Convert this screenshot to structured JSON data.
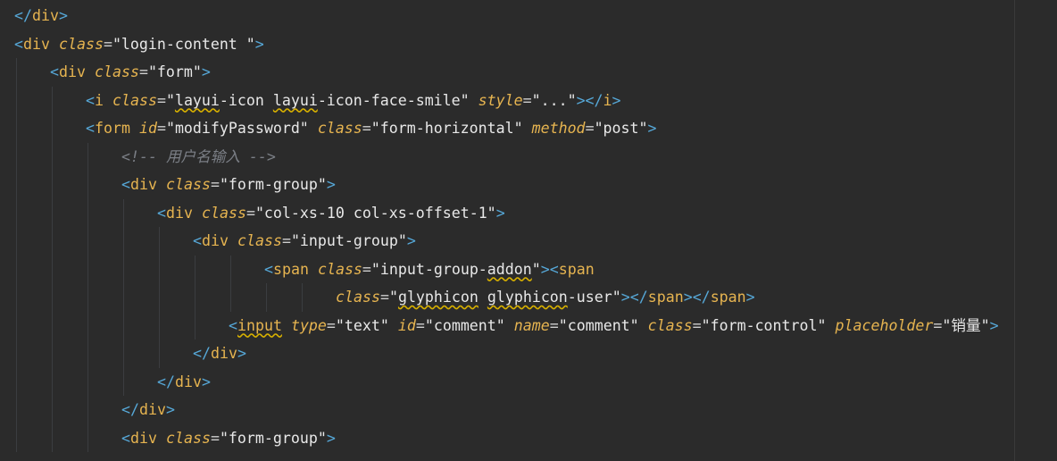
{
  "editor": {
    "language": "html",
    "lines": [
      {
        "indent": 0,
        "tokens": [
          {
            "k": "b",
            "v": "</"
          },
          {
            "k": "t",
            "v": "div"
          },
          {
            "k": "b",
            "v": ">"
          }
        ]
      },
      {
        "indent": 0,
        "tokens": [
          {
            "k": "b",
            "v": "<"
          },
          {
            "k": "t",
            "v": "div"
          },
          {
            "k": "p",
            "v": " "
          },
          {
            "k": "a",
            "v": "class"
          },
          {
            "k": "p",
            "v": "="
          },
          {
            "k": "s",
            "v": "\"login-content \""
          },
          {
            "k": "b",
            "v": ">"
          }
        ]
      },
      {
        "indent": 2,
        "tokens": [
          {
            "k": "b",
            "v": "<"
          },
          {
            "k": "t",
            "v": "div"
          },
          {
            "k": "p",
            "v": " "
          },
          {
            "k": "a",
            "v": "class"
          },
          {
            "k": "p",
            "v": "="
          },
          {
            "k": "s",
            "v": "\"form\""
          },
          {
            "k": "b",
            "v": ">"
          }
        ]
      },
      {
        "indent": 4,
        "tokens": [
          {
            "k": "b",
            "v": "<"
          },
          {
            "k": "t",
            "v": "i"
          },
          {
            "k": "p",
            "v": " "
          },
          {
            "k": "a",
            "v": "class"
          },
          {
            "k": "p",
            "v": "="
          },
          {
            "k": "s",
            "v": "\""
          },
          {
            "k": "s",
            "v": "layui",
            "sq": true
          },
          {
            "k": "s",
            "v": "-icon "
          },
          {
            "k": "s",
            "v": "layui",
            "sq": true
          },
          {
            "k": "s",
            "v": "-icon-face-smile\""
          },
          {
            "k": "p",
            "v": " "
          },
          {
            "k": "a",
            "v": "style"
          },
          {
            "k": "p",
            "v": "="
          },
          {
            "k": "s",
            "v": "\"...\""
          },
          {
            "k": "b",
            "v": "></"
          },
          {
            "k": "t",
            "v": "i"
          },
          {
            "k": "b",
            "v": ">"
          }
        ]
      },
      {
        "indent": 4,
        "tokens": [
          {
            "k": "b",
            "v": "<"
          },
          {
            "k": "t",
            "v": "form"
          },
          {
            "k": "p",
            "v": " "
          },
          {
            "k": "a",
            "v": "id"
          },
          {
            "k": "p",
            "v": "="
          },
          {
            "k": "s",
            "v": "\"modifyPassword\""
          },
          {
            "k": "p",
            "v": " "
          },
          {
            "k": "a",
            "v": "class"
          },
          {
            "k": "p",
            "v": "="
          },
          {
            "k": "s",
            "v": "\"form-horizontal\""
          },
          {
            "k": "p",
            "v": " "
          },
          {
            "k": "a",
            "v": "method"
          },
          {
            "k": "p",
            "v": "="
          },
          {
            "k": "s",
            "v": "\"post\""
          },
          {
            "k": "b",
            "v": ">"
          }
        ]
      },
      {
        "indent": 6,
        "tokens": [
          {
            "k": "c",
            "v": "<!-- 用户名输入 -->"
          }
        ]
      },
      {
        "indent": 6,
        "tokens": [
          {
            "k": "b",
            "v": "<"
          },
          {
            "k": "t",
            "v": "div"
          },
          {
            "k": "p",
            "v": " "
          },
          {
            "k": "a",
            "v": "class"
          },
          {
            "k": "p",
            "v": "="
          },
          {
            "k": "s",
            "v": "\"form-group\""
          },
          {
            "k": "b",
            "v": ">"
          }
        ]
      },
      {
        "indent": 8,
        "tokens": [
          {
            "k": "b",
            "v": "<"
          },
          {
            "k": "t",
            "v": "div"
          },
          {
            "k": "p",
            "v": " "
          },
          {
            "k": "a",
            "v": "class"
          },
          {
            "k": "p",
            "v": "="
          },
          {
            "k": "s",
            "v": "\"col-xs-10 col-xs-offset-1\""
          },
          {
            "k": "b",
            "v": ">"
          }
        ]
      },
      {
        "indent": 10,
        "tokens": [
          {
            "k": "b",
            "v": "<"
          },
          {
            "k": "t",
            "v": "div"
          },
          {
            "k": "p",
            "v": " "
          },
          {
            "k": "a",
            "v": "class"
          },
          {
            "k": "p",
            "v": "="
          },
          {
            "k": "s",
            "v": "\"input-group\""
          },
          {
            "k": "b",
            "v": ">"
          }
        ]
      },
      {
        "indent": 14,
        "tokens": [
          {
            "k": "b",
            "v": "<"
          },
          {
            "k": "t",
            "v": "span"
          },
          {
            "k": "p",
            "v": " "
          },
          {
            "k": "a",
            "v": "class"
          },
          {
            "k": "p",
            "v": "="
          },
          {
            "k": "s",
            "v": "\"input-group-"
          },
          {
            "k": "s",
            "v": "addon",
            "sq": true
          },
          {
            "k": "s",
            "v": "\""
          },
          {
            "k": "b",
            "v": "><"
          },
          {
            "k": "t",
            "v": "span"
          }
        ]
      },
      {
        "indent": 18,
        "tokens": [
          {
            "k": "a",
            "v": "class"
          },
          {
            "k": "p",
            "v": "="
          },
          {
            "k": "s",
            "v": "\""
          },
          {
            "k": "s",
            "v": "glyphicon",
            "sq": true
          },
          {
            "k": "s",
            "v": " "
          },
          {
            "k": "s",
            "v": "glyphicon",
            "sq": true
          },
          {
            "k": "s",
            "v": "-user\""
          },
          {
            "k": "b",
            "v": "></"
          },
          {
            "k": "t",
            "v": "span"
          },
          {
            "k": "b",
            "v": "></"
          },
          {
            "k": "t",
            "v": "span"
          },
          {
            "k": "b",
            "v": ">"
          }
        ]
      },
      {
        "indent": 12,
        "tokens": [
          {
            "k": "b",
            "v": "<"
          },
          {
            "k": "t",
            "v": "input",
            "sq": true
          },
          {
            "k": "p",
            "v": " "
          },
          {
            "k": "a",
            "v": "type"
          },
          {
            "k": "p",
            "v": "="
          },
          {
            "k": "s",
            "v": "\"text\""
          },
          {
            "k": "p",
            "v": " "
          },
          {
            "k": "a",
            "v": "id"
          },
          {
            "k": "p",
            "v": "="
          },
          {
            "k": "s",
            "v": "\"comment\""
          },
          {
            "k": "p",
            "v": " "
          },
          {
            "k": "a",
            "v": "name"
          },
          {
            "k": "p",
            "v": "="
          },
          {
            "k": "s",
            "v": "\"comment\""
          },
          {
            "k": "p",
            "v": " "
          },
          {
            "k": "a",
            "v": "class"
          },
          {
            "k": "p",
            "v": "="
          },
          {
            "k": "s",
            "v": "\"form-control\""
          },
          {
            "k": "p",
            "v": " "
          },
          {
            "k": "a",
            "v": "placeholder"
          },
          {
            "k": "p",
            "v": "="
          },
          {
            "k": "s",
            "v": "\"销量\""
          },
          {
            "k": "b",
            "v": ">"
          }
        ]
      },
      {
        "indent": 10,
        "tokens": [
          {
            "k": "b",
            "v": "</"
          },
          {
            "k": "t",
            "v": "div"
          },
          {
            "k": "b",
            "v": ">"
          }
        ]
      },
      {
        "indent": 8,
        "tokens": [
          {
            "k": "b",
            "v": "</"
          },
          {
            "k": "t",
            "v": "div"
          },
          {
            "k": "b",
            "v": ">"
          }
        ]
      },
      {
        "indent": 6,
        "tokens": [
          {
            "k": "b",
            "v": "</"
          },
          {
            "k": "t",
            "v": "div"
          },
          {
            "k": "b",
            "v": ">"
          }
        ]
      },
      {
        "indent": 6,
        "tokens": [
          {
            "k": "b",
            "v": "<"
          },
          {
            "k": "t",
            "v": "div"
          },
          {
            "k": "p",
            "v": " "
          },
          {
            "k": "a",
            "v": "class"
          },
          {
            "k": "p",
            "v": "="
          },
          {
            "k": "s",
            "v": "\"form-group\""
          },
          {
            "k": "b",
            "v": ">"
          }
        ]
      }
    ]
  }
}
